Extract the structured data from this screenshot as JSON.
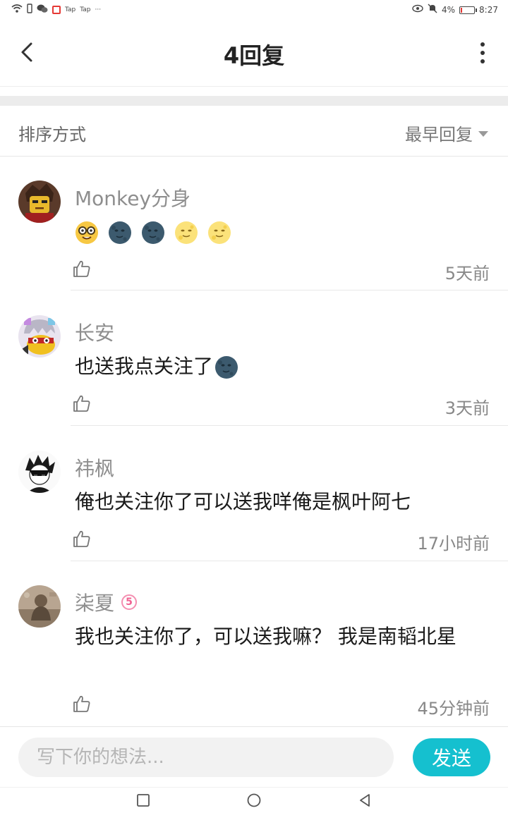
{
  "status_bar": {
    "app1": "Tap",
    "app2": "Tap",
    "dots": "···",
    "battery": "4%",
    "time": "8:27"
  },
  "header": {
    "title": "4回复"
  },
  "sort": {
    "label": "排序方式",
    "value": "最早回复"
  },
  "comments": [
    {
      "name": "Monkey分身",
      "text": "",
      "emojis": [
        "nerd-face",
        "new-moon-face",
        "new-moon-face",
        "full-moon-face",
        "full-moon-face"
      ],
      "time": "5天前"
    },
    {
      "name": "长安",
      "text": "也送我点关注了",
      "emojis": [
        "new-moon-face"
      ],
      "time": "3天前"
    },
    {
      "name": "祎枫",
      "text": "俺也关注你了可以送我咩俺是枫叶阿七",
      "emojis": [],
      "time": "17小时前"
    },
    {
      "name": "柒夏",
      "badge": "5",
      "text": "我也关注你了，可以送我嘛？ 我是南韬北星",
      "emojis": [],
      "time": "45分钟前"
    }
  ],
  "composer": {
    "placeholder": "写下你的想法...",
    "send_label": "发送"
  },
  "colors": {
    "accent": "#15c0cf",
    "badge": "#f06292"
  }
}
